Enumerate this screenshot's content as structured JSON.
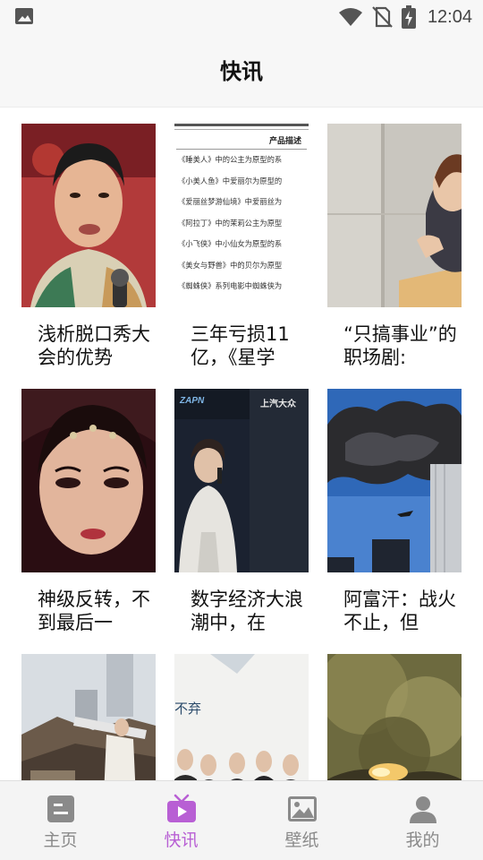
{
  "status_bar": {
    "time": "12:04",
    "icons": [
      "gallery-icon",
      "wifi-icon",
      "no-sim-icon",
      "battery-charging-icon"
    ]
  },
  "header": {
    "title": "快讯"
  },
  "news": [
    {
      "title": "浅析脱口秀大会的优势",
      "image": "man-with-microphone-photo"
    },
    {
      "title": "三年亏损11亿，《星学",
      "image": "product-description-document",
      "image_text": {
        "heading": "产品描述",
        "lines": [
          "《睡美人》中的公主为原型的系",
          "《小美人鱼》中爱丽尔为原型的",
          "《爱丽丝梦游仙境》中爱丽丝为",
          "《阿拉丁》中的茉莉公主为原型",
          "《小飞侠》中小仙女为原型的系",
          "《美女与野兽》中的贝尔为原型",
          "《蜘蛛侠》系列电影中蜘蛛侠为"
        ]
      }
    },
    {
      "title": "“只搞事业”的职场剧:",
      "image": "woman-leaning-on-wall-photo"
    },
    {
      "title": "神级反转，不到最后一",
      "image": "woman-stage-makeup-photo"
    },
    {
      "title": "数字经济大浪潮中，在",
      "image": "singer-on-stage-photo",
      "image_text": {
        "banner_left": "ZAPN",
        "banner_right": "上汽大众"
      }
    },
    {
      "title": "阿富汗：战火不止，但",
      "image": "tower-smoke-photo"
    },
    {
      "title": "",
      "image": "rooftop-costume-photo"
    },
    {
      "title": "",
      "image": "group-on-stage-photo",
      "image_text": {
        "text": "不弃"
      }
    },
    {
      "title": "",
      "image": "battlefield-smoke-photo"
    }
  ],
  "bottom_nav": [
    {
      "label": "主页",
      "icon": "home-icon",
      "active": false
    },
    {
      "label": "快讯",
      "icon": "tv-icon",
      "active": true
    },
    {
      "label": "壁纸",
      "icon": "wallpaper-icon",
      "active": false
    },
    {
      "label": "我的",
      "icon": "profile-icon",
      "active": false
    }
  ],
  "colors": {
    "accent": "#b85fd4",
    "inactive": "#8a8a8a",
    "header_bg": "#f7f7f7",
    "nav_bg": "#f4f4f4"
  }
}
